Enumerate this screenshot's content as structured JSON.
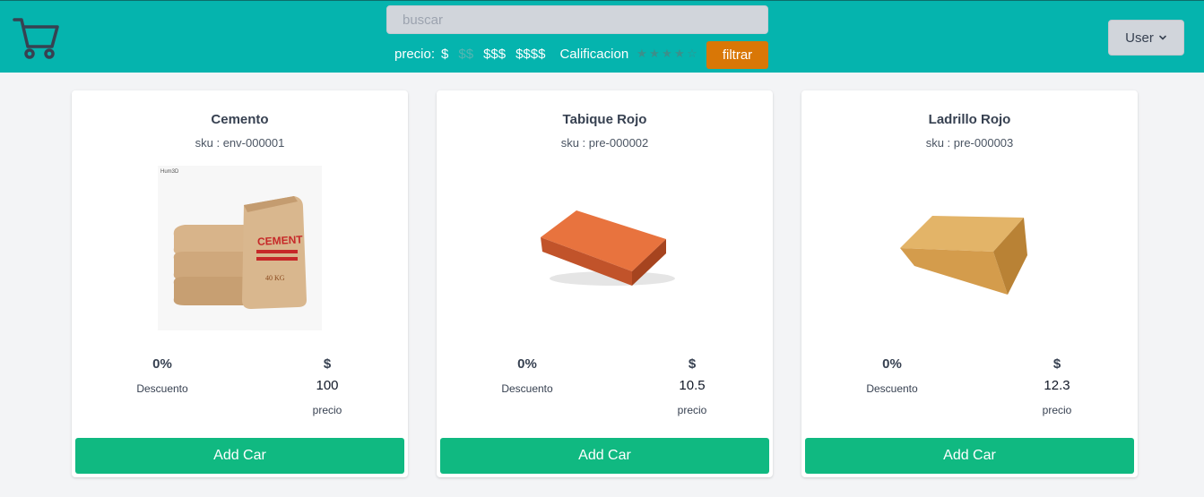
{
  "header": {
    "search_placeholder": "buscar",
    "price_label": "precio:",
    "price_options": [
      "$",
      "$$",
      "$$$",
      "$$$$"
    ],
    "rating_label": "Calificacion",
    "rating_stars": 5,
    "rating_selected": 4,
    "filter_button": "filtrar",
    "user_button": "User",
    "icons": {
      "cart": "shopping-cart-icon",
      "user_dropdown": "chevron-down-icon"
    }
  },
  "products": [
    {
      "name": "Cemento",
      "sku": "sku : env-000001",
      "discount": "0%",
      "discount_label": "Descuento",
      "currency": "$",
      "price": "100",
      "price_label": "precio",
      "button": "Add Car",
      "image_label": "CEMENT",
      "image_weight": "40 KG",
      "image_watermark": "Hum3D"
    },
    {
      "name": "Tabique Rojo",
      "sku": "sku : pre-000002",
      "discount": "0%",
      "discount_label": "Descuento",
      "currency": "$",
      "price": "10.5",
      "price_label": "precio",
      "button": "Add Car"
    },
    {
      "name": "Ladrillo Rojo",
      "sku": "sku : pre-000003",
      "discount": "0%",
      "discount_label": "Descuento",
      "currency": "$",
      "price": "12.3",
      "price_label": "precio",
      "button": "Add Car"
    }
  ],
  "colors": {
    "header_bg": "#05b4ae",
    "filter_button_bg": "#d97706",
    "add_button_bg": "#10b981",
    "page_bg": "#f3f4f6"
  }
}
